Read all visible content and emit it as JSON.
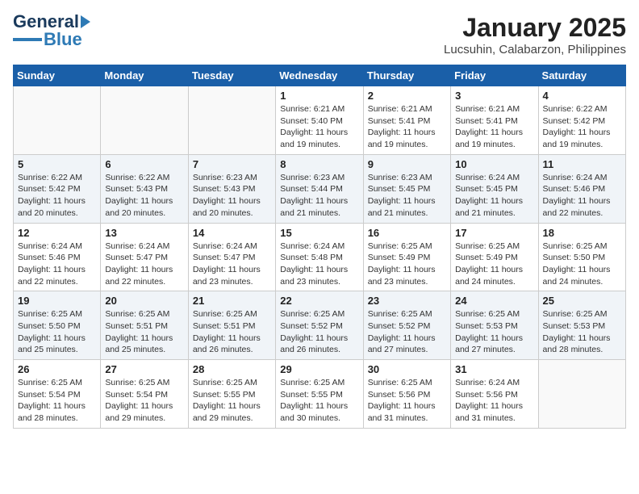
{
  "logo": {
    "line1": "General",
    "line2": "Blue"
  },
  "header": {
    "month": "January 2025",
    "location": "Lucsuhin, Calabarzon, Philippines"
  },
  "days_of_week": [
    "Sunday",
    "Monday",
    "Tuesday",
    "Wednesday",
    "Thursday",
    "Friday",
    "Saturday"
  ],
  "weeks": [
    [
      {
        "day": "",
        "info": ""
      },
      {
        "day": "",
        "info": ""
      },
      {
        "day": "",
        "info": ""
      },
      {
        "day": "1",
        "info": "Sunrise: 6:21 AM\nSunset: 5:40 PM\nDaylight: 11 hours and 19 minutes."
      },
      {
        "day": "2",
        "info": "Sunrise: 6:21 AM\nSunset: 5:41 PM\nDaylight: 11 hours and 19 minutes."
      },
      {
        "day": "3",
        "info": "Sunrise: 6:21 AM\nSunset: 5:41 PM\nDaylight: 11 hours and 19 minutes."
      },
      {
        "day": "4",
        "info": "Sunrise: 6:22 AM\nSunset: 5:42 PM\nDaylight: 11 hours and 19 minutes."
      }
    ],
    [
      {
        "day": "5",
        "info": "Sunrise: 6:22 AM\nSunset: 5:42 PM\nDaylight: 11 hours and 20 minutes."
      },
      {
        "day": "6",
        "info": "Sunrise: 6:22 AM\nSunset: 5:43 PM\nDaylight: 11 hours and 20 minutes."
      },
      {
        "day": "7",
        "info": "Sunrise: 6:23 AM\nSunset: 5:43 PM\nDaylight: 11 hours and 20 minutes."
      },
      {
        "day": "8",
        "info": "Sunrise: 6:23 AM\nSunset: 5:44 PM\nDaylight: 11 hours and 21 minutes."
      },
      {
        "day": "9",
        "info": "Sunrise: 6:23 AM\nSunset: 5:45 PM\nDaylight: 11 hours and 21 minutes."
      },
      {
        "day": "10",
        "info": "Sunrise: 6:24 AM\nSunset: 5:45 PM\nDaylight: 11 hours and 21 minutes."
      },
      {
        "day": "11",
        "info": "Sunrise: 6:24 AM\nSunset: 5:46 PM\nDaylight: 11 hours and 22 minutes."
      }
    ],
    [
      {
        "day": "12",
        "info": "Sunrise: 6:24 AM\nSunset: 5:46 PM\nDaylight: 11 hours and 22 minutes."
      },
      {
        "day": "13",
        "info": "Sunrise: 6:24 AM\nSunset: 5:47 PM\nDaylight: 11 hours and 22 minutes."
      },
      {
        "day": "14",
        "info": "Sunrise: 6:24 AM\nSunset: 5:47 PM\nDaylight: 11 hours and 23 minutes."
      },
      {
        "day": "15",
        "info": "Sunrise: 6:24 AM\nSunset: 5:48 PM\nDaylight: 11 hours and 23 minutes."
      },
      {
        "day": "16",
        "info": "Sunrise: 6:25 AM\nSunset: 5:49 PM\nDaylight: 11 hours and 23 minutes."
      },
      {
        "day": "17",
        "info": "Sunrise: 6:25 AM\nSunset: 5:49 PM\nDaylight: 11 hours and 24 minutes."
      },
      {
        "day": "18",
        "info": "Sunrise: 6:25 AM\nSunset: 5:50 PM\nDaylight: 11 hours and 24 minutes."
      }
    ],
    [
      {
        "day": "19",
        "info": "Sunrise: 6:25 AM\nSunset: 5:50 PM\nDaylight: 11 hours and 25 minutes."
      },
      {
        "day": "20",
        "info": "Sunrise: 6:25 AM\nSunset: 5:51 PM\nDaylight: 11 hours and 25 minutes."
      },
      {
        "day": "21",
        "info": "Sunrise: 6:25 AM\nSunset: 5:51 PM\nDaylight: 11 hours and 26 minutes."
      },
      {
        "day": "22",
        "info": "Sunrise: 6:25 AM\nSunset: 5:52 PM\nDaylight: 11 hours and 26 minutes."
      },
      {
        "day": "23",
        "info": "Sunrise: 6:25 AM\nSunset: 5:52 PM\nDaylight: 11 hours and 27 minutes."
      },
      {
        "day": "24",
        "info": "Sunrise: 6:25 AM\nSunset: 5:53 PM\nDaylight: 11 hours and 27 minutes."
      },
      {
        "day": "25",
        "info": "Sunrise: 6:25 AM\nSunset: 5:53 PM\nDaylight: 11 hours and 28 minutes."
      }
    ],
    [
      {
        "day": "26",
        "info": "Sunrise: 6:25 AM\nSunset: 5:54 PM\nDaylight: 11 hours and 28 minutes."
      },
      {
        "day": "27",
        "info": "Sunrise: 6:25 AM\nSunset: 5:54 PM\nDaylight: 11 hours and 29 minutes."
      },
      {
        "day": "28",
        "info": "Sunrise: 6:25 AM\nSunset: 5:55 PM\nDaylight: 11 hours and 29 minutes."
      },
      {
        "day": "29",
        "info": "Sunrise: 6:25 AM\nSunset: 5:55 PM\nDaylight: 11 hours and 30 minutes."
      },
      {
        "day": "30",
        "info": "Sunrise: 6:25 AM\nSunset: 5:56 PM\nDaylight: 11 hours and 31 minutes."
      },
      {
        "day": "31",
        "info": "Sunrise: 6:24 AM\nSunset: 5:56 PM\nDaylight: 11 hours and 31 minutes."
      },
      {
        "day": "",
        "info": ""
      }
    ]
  ]
}
